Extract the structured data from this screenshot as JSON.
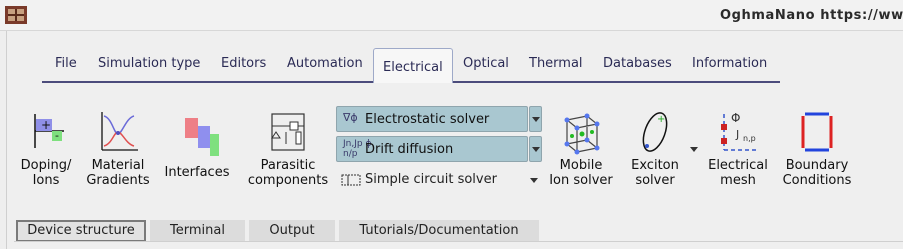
{
  "window": {
    "title": "OghmaNano https://www.o"
  },
  "menu": {
    "items": [
      "File",
      "Simulation type",
      "Editors",
      "Automation",
      "Electrical",
      "Optical",
      "Thermal",
      "Databases",
      "Information"
    ],
    "active": "Electrical"
  },
  "toolbar": {
    "doping_l1": "Doping/",
    "doping_l2": "Ions",
    "material_l1": "Material",
    "material_l2": "Gradients",
    "interfaces": "Interfaces",
    "parasitic_l1": "Parasitic",
    "parasitic_l2": "components",
    "electrostatic_solver": "Electrostatic solver",
    "drift_diffusion": "Drift diffusion",
    "simple_circuit_solver": "Simple circuit solver",
    "mobile_l1": "Mobile",
    "mobile_l2": "Ion solver",
    "exciton_l1": "Exciton",
    "exciton_l2": "solver",
    "mesh_l1": "Electrical",
    "mesh_l2": "mesh",
    "boundary_l1": "Boundary",
    "boundary_l2": "Conditions"
  },
  "bottom_tabs": {
    "items": [
      "Device structure",
      "Terminal",
      "Output",
      "Tutorials/Documentation"
    ],
    "active": "Device structure"
  },
  "icons": {
    "app": "app-icon",
    "doping": "doping-icon",
    "material": "material-gradient-icon",
    "interfaces": "interfaces-icon",
    "parasitic": "circuit-icon",
    "electrostatic": "phi-icon",
    "drift": "drift-icon",
    "circuit": "simple-circuit-icon",
    "mobile": "crystal-lattice-icon",
    "exciton": "exciton-icon",
    "mesh": "mesh-icon",
    "boundary": "boundary-icon"
  }
}
